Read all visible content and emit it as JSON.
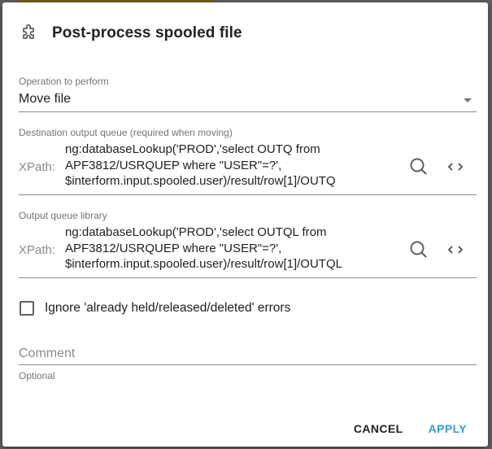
{
  "dialog": {
    "title": "Post-process spooled file",
    "title_icon": "puzzle-piece-icon"
  },
  "operation": {
    "label": "Operation to perform",
    "value": "Move file"
  },
  "destination_queue": {
    "label": "Destination output queue (required when moving)",
    "prefix": "XPath:",
    "value": "ng:databaseLookup('PROD','select OUTQ from\nAPF3812/USRQUEP where \"USER\"=?',\n$interform.input.spooled.user)/result/row[1]/OUTQ"
  },
  "queue_library": {
    "label": "Output queue library",
    "prefix": "XPath:",
    "value": "ng:databaseLookup('PROD','select OUTQL from\nAPF3812/USRQUEP where \"USER\"=?',\n$interform.input.spooled.user)/result/row[1]/OUTQL"
  },
  "ignore_errors": {
    "label": "Ignore 'already held/released/deleted' errors",
    "checked": false
  },
  "comment": {
    "placeholder": "Comment",
    "value": "",
    "hint": "Optional"
  },
  "actions": {
    "cancel_label": "CANCEL",
    "apply_label": "APPLY"
  },
  "colors": {
    "accent": "#3a9bd9",
    "text": "#212121",
    "secondary_text": "#757575"
  }
}
